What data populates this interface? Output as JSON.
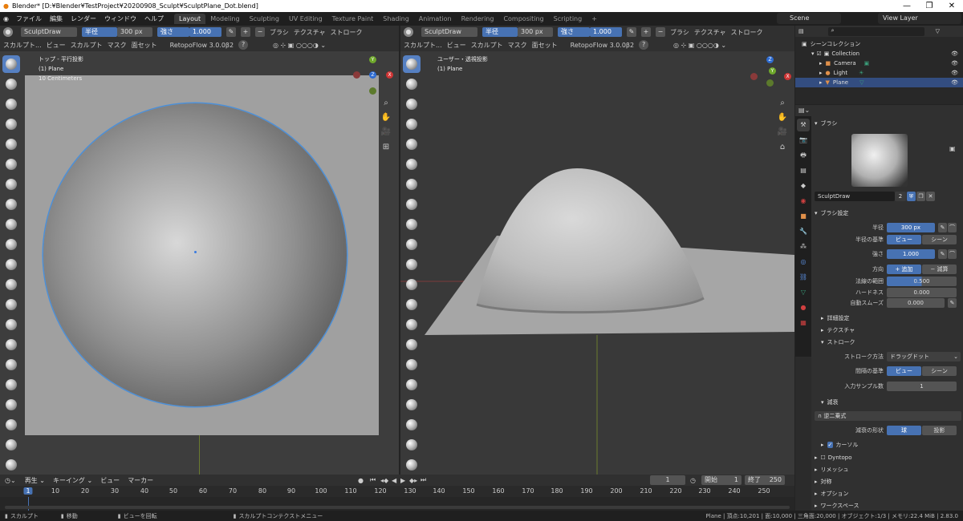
{
  "window": {
    "title": "Blender* [D:¥Blender¥TestProject¥20200908_Sculpt¥SculptPlane_Dot.blend]",
    "minimize": "—",
    "maximize": "❐",
    "close": "✕"
  },
  "menus": [
    "ファイル",
    "編集",
    "レンダー",
    "ウィンドウ",
    "ヘルプ"
  ],
  "workspaces": [
    "Layout",
    "Modeling",
    "Sculpting",
    "UV Editing",
    "Texture Paint",
    "Shading",
    "Animation",
    "Rendering",
    "Compositing",
    "Scripting"
  ],
  "active_workspace": "Layout",
  "add_workspace": "+",
  "scene": "Scene",
  "view_layer": "View Layer",
  "left_view": {
    "brush_name": "SculptDraw",
    "radius_label": "半径",
    "radius_value": "300 px",
    "strength_label": "強さ",
    "strength_value": "1.000",
    "brush_menu": "ブラシ",
    "texture_menu": "テクスチャ",
    "stroke_menu": "ストローク",
    "mode": "スカルプト...",
    "menu_view": "ビュー",
    "menu_sculpt": "スカルプト",
    "menu_mask": "マスク",
    "menu_faceset": "面セット",
    "addon": "RetopoFlow 3.0.0β2",
    "help": "?",
    "overlay_line1": "トップ - 平行投影",
    "overlay_line2": "(1) Plane",
    "overlay_line3": "10 Centimeters"
  },
  "right_view": {
    "brush_name": "SculptDraw",
    "radius_label": "半径",
    "radius_value": "300 px",
    "strength_label": "強さ",
    "strength_value": "1.000",
    "brush_menu": "ブラシ",
    "texture_menu": "テクスチャ",
    "stroke_menu": "ストローク",
    "mode": "スカルプト...",
    "menu_view": "ビュー",
    "menu_sculpt": "スカルプト",
    "menu_mask": "マスク",
    "menu_faceset": "面セット",
    "addon": "RetopoFlow 3.0.0β2",
    "help": "?",
    "overlay_line1": "ユーザー・透視投影",
    "overlay_line2": "(1) Plane"
  },
  "gizmo": {
    "y": "Y",
    "z": "Z",
    "x": "X"
  },
  "outliner": {
    "root": "シーンコレクション",
    "collection": "Collection",
    "items": [
      "Camera",
      "Light",
      "Plane"
    ],
    "selected": "Plane"
  },
  "properties": {
    "brush_section": "ブラシ",
    "brush_name": "SculptDraw",
    "brush_users": "2",
    "brush_settings": "ブラシ設定",
    "radius_label": "半径",
    "radius_value": "300 px",
    "radius_unit_label": "半径の基準",
    "radius_unit_view": "ビュー",
    "radius_unit_scene": "シーン",
    "strength_label": "強さ",
    "strength_value": "1.000",
    "direction_label": "方向",
    "direction_add": "追加",
    "direction_sub": "減算",
    "normal_radius_label": "法線の範囲",
    "normal_radius_value": "0.500",
    "hardness_label": "ハードネス",
    "hardness_value": "0.000",
    "autosmooth_label": "自動スムーズ",
    "autosmooth_value": "0.000",
    "advanced": "詳細設定",
    "texture": "テクスチャ",
    "stroke": "ストローク",
    "stroke_method_label": "ストローク方法",
    "stroke_method_value": "ドラッグドット",
    "spacing_label": "間隔の基準",
    "spacing_view": "ビュー",
    "spacing_scene": "シーン",
    "input_samples_label": "入力サンプル数",
    "input_samples_value": "1",
    "falloff": "減衰",
    "falloff_curve": "逆二乗式",
    "falloff_shape_label": "減衰の形状",
    "falloff_shape_sphere": "球",
    "falloff_shape_projected": "投影",
    "cursor": "カーソル",
    "dyntopo": "Dyntopo",
    "remesh": "リメッシュ",
    "symmetry": "対称",
    "options": "オプション",
    "workspace": "ワークスペース"
  },
  "timeline": {
    "playback": "再生",
    "keying": "キーイング",
    "view": "ビュー",
    "marker": "マーカー",
    "current_frame": "1",
    "start_label": "開始",
    "start_value": "1",
    "end_label": "終了",
    "end_value": "250",
    "ticks": [
      "1",
      "10",
      "20",
      "30",
      "40",
      "50",
      "60",
      "70",
      "80",
      "90",
      "100",
      "110",
      "120",
      "130",
      "140",
      "150",
      "160",
      "170",
      "180",
      "190",
      "200",
      "210",
      "220",
      "230",
      "240",
      "250"
    ]
  },
  "status": {
    "sculpt": "スカルプト",
    "move": "移動",
    "rotate_view": "ビューを回転",
    "context_menu": "スカルプトコンテクストメニュー",
    "stats": "Plane | 頂点:10,201 | 面:10,000 | 三角面:20,000 | オブジェクト:1/3 | メモリ:22.4 MiB | 2.83.0"
  }
}
